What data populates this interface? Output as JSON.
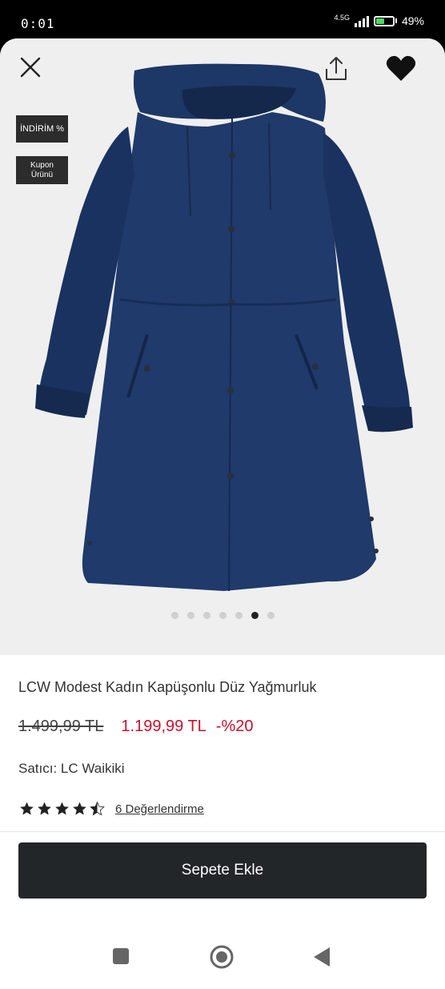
{
  "status_bar": {
    "time": "0:01",
    "network": "4.5G",
    "battery_percent": "49%",
    "battery_level": 0.49,
    "battery_color": "#4cd964"
  },
  "gallery": {
    "badges": {
      "discount": "İNDİRİM %",
      "coupon": "Kupon Ürünü"
    },
    "image_count": 7,
    "active_image_index": 5,
    "background_color": "#efefef",
    "coat_color": "#1c3563"
  },
  "toolbar": {
    "close_icon": "close-icon",
    "share_icon": "share-icon",
    "favorite_icon": "heart-icon"
  },
  "product": {
    "title": "LCW Modest Kadın Kapüşonlu Düz Yağmurluk",
    "old_price": "1.499,99 TL",
    "new_price": "1.199,99 TL",
    "discount": "-%20",
    "seller_label": "Satıcı:",
    "seller_name": "LC Waikiki",
    "rating": 4.5,
    "review_link": "6 Değerlendirme",
    "price_color": "#c8102e"
  },
  "actions": {
    "add_to_cart": "Sepete Ekle",
    "button_color": "#232629"
  },
  "navigation": {
    "recents_icon": "square-icon",
    "home_icon": "home-circle-icon",
    "back_icon": "back-triangle-icon"
  }
}
